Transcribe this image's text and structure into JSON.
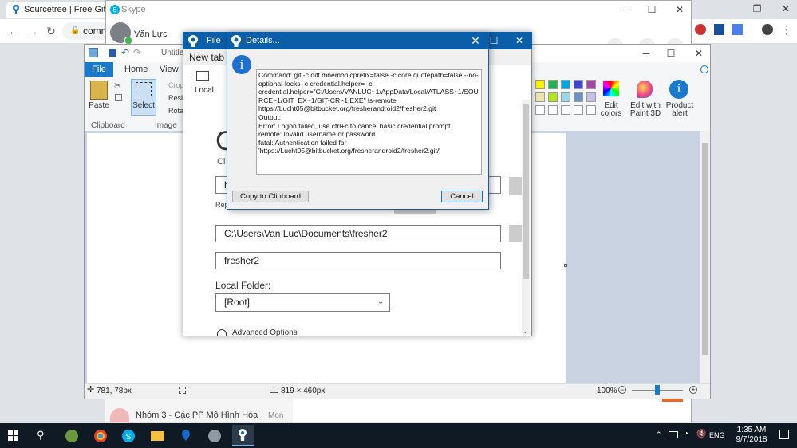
{
  "chrome": {
    "tab_title": "Sourcetree | Free Git GUI",
    "address": "comm"
  },
  "skype": {
    "title": "Skype",
    "user_name": "Văn Lực",
    "chat_item": "Nhóm 3 - Các PP Mô Hình Hóa",
    "chat_time": "Mon"
  },
  "paint": {
    "title": "Untitle",
    "tabs": [
      "File",
      "Home",
      "View"
    ],
    "clipboard": {
      "paste_label": "Paste",
      "group_label": "Clipboard"
    },
    "image": {
      "select_label": "Select",
      "crop_label": "Crop",
      "resize_label": "Resi",
      "rotate_label": "Rota",
      "group_label": "Image"
    },
    "edit_colors_label": "Edit colors",
    "edit_paint3d_label": "Edit with Paint 3D",
    "product_alert_label": "Product alert",
    "status": {
      "cursor_pos": "781, 78px",
      "canvas_size": "819 × 460px",
      "zoom": "100%"
    }
  },
  "sourcetree": {
    "file_label": "File",
    "new_tab_label": "New tab",
    "local_label": "Local",
    "heading_letter": "C",
    "sub_letter": "Cl",
    "field_source_letter": "h",
    "repo_label": "Rep",
    "path_value": "C:\\Users\\Van Luc\\Documents\\fresher2",
    "name_value": "fresher2",
    "local_folder_label": "Local Folder:",
    "local_folder_value": "[Root]",
    "advanced_label": "Advanced Options"
  },
  "dialog": {
    "title": "Details...",
    "message": "Command: git -c diff.mnemonicprefix=false -c core.quotepath=false --no-optional-locks -c credential.helper= -c credential.helper=\"C:/Users/VANLUC~1/AppData/Local/ATLASS~1/SOURCE~1/GIT_EX~1/GIT-CR~1.EXE\" ls-remote https://Lucht05@bitbucket.org/fresherandroid2/fresher2.git\nOutput:\nError: Logon failed, use ctrl+c to cancel basic credential prompt.\nremote: Invalid username or password\nfatal: Authentication failed for 'https://Lucht05@bitbucket.org/fresherandroid2/fresher2.git/'",
    "copy_label": "Copy to Clipboard",
    "cancel_label": "Cancel"
  },
  "taskbar": {
    "language": "ENG",
    "time": "1:35 AM",
    "date": "9/7/2018"
  },
  "colors": {
    "accent_blue": "#0b5ea8",
    "paint_file_blue": "#1979ca",
    "taskbar": "#101a24"
  }
}
